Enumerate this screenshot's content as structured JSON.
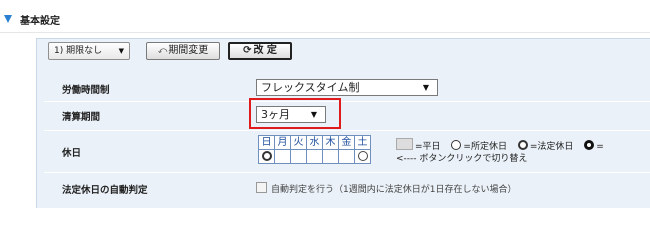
{
  "section": {
    "title": "基本設定"
  },
  "toolbar": {
    "period_select": "1) 期限なし",
    "period_change_label": "期間変更",
    "revise_label": "改 定"
  },
  "rows": {
    "labor_system_label": "労働時間制",
    "labor_system_value": "フレックスタイム制",
    "settlement_label": "清算期間",
    "settlement_value": "3ヶ月",
    "holiday_label": "休日",
    "weekdays": [
      "日",
      "月",
      "火",
      "水",
      "木",
      "金",
      "土"
    ],
    "holiday_symbols": [
      "legal",
      "none",
      "none",
      "none",
      "none",
      "none",
      "scheduled"
    ],
    "legend": {
      "weekday": "=平日",
      "scheduled": "=所定休日",
      "legal": "=法定休日",
      "extra": "="
    },
    "hint": "<---- ボタンクリックで切り替え",
    "auto_label": "法定休日の自動判定",
    "auto_checkbox_label": "自動判定を行う（1週間内に法定休日が1日存在しない場合）"
  },
  "colors": {
    "accent": "#2a7fd0",
    "highlight": "#e01b1b",
    "panel_bg": "#eaf1f8"
  }
}
